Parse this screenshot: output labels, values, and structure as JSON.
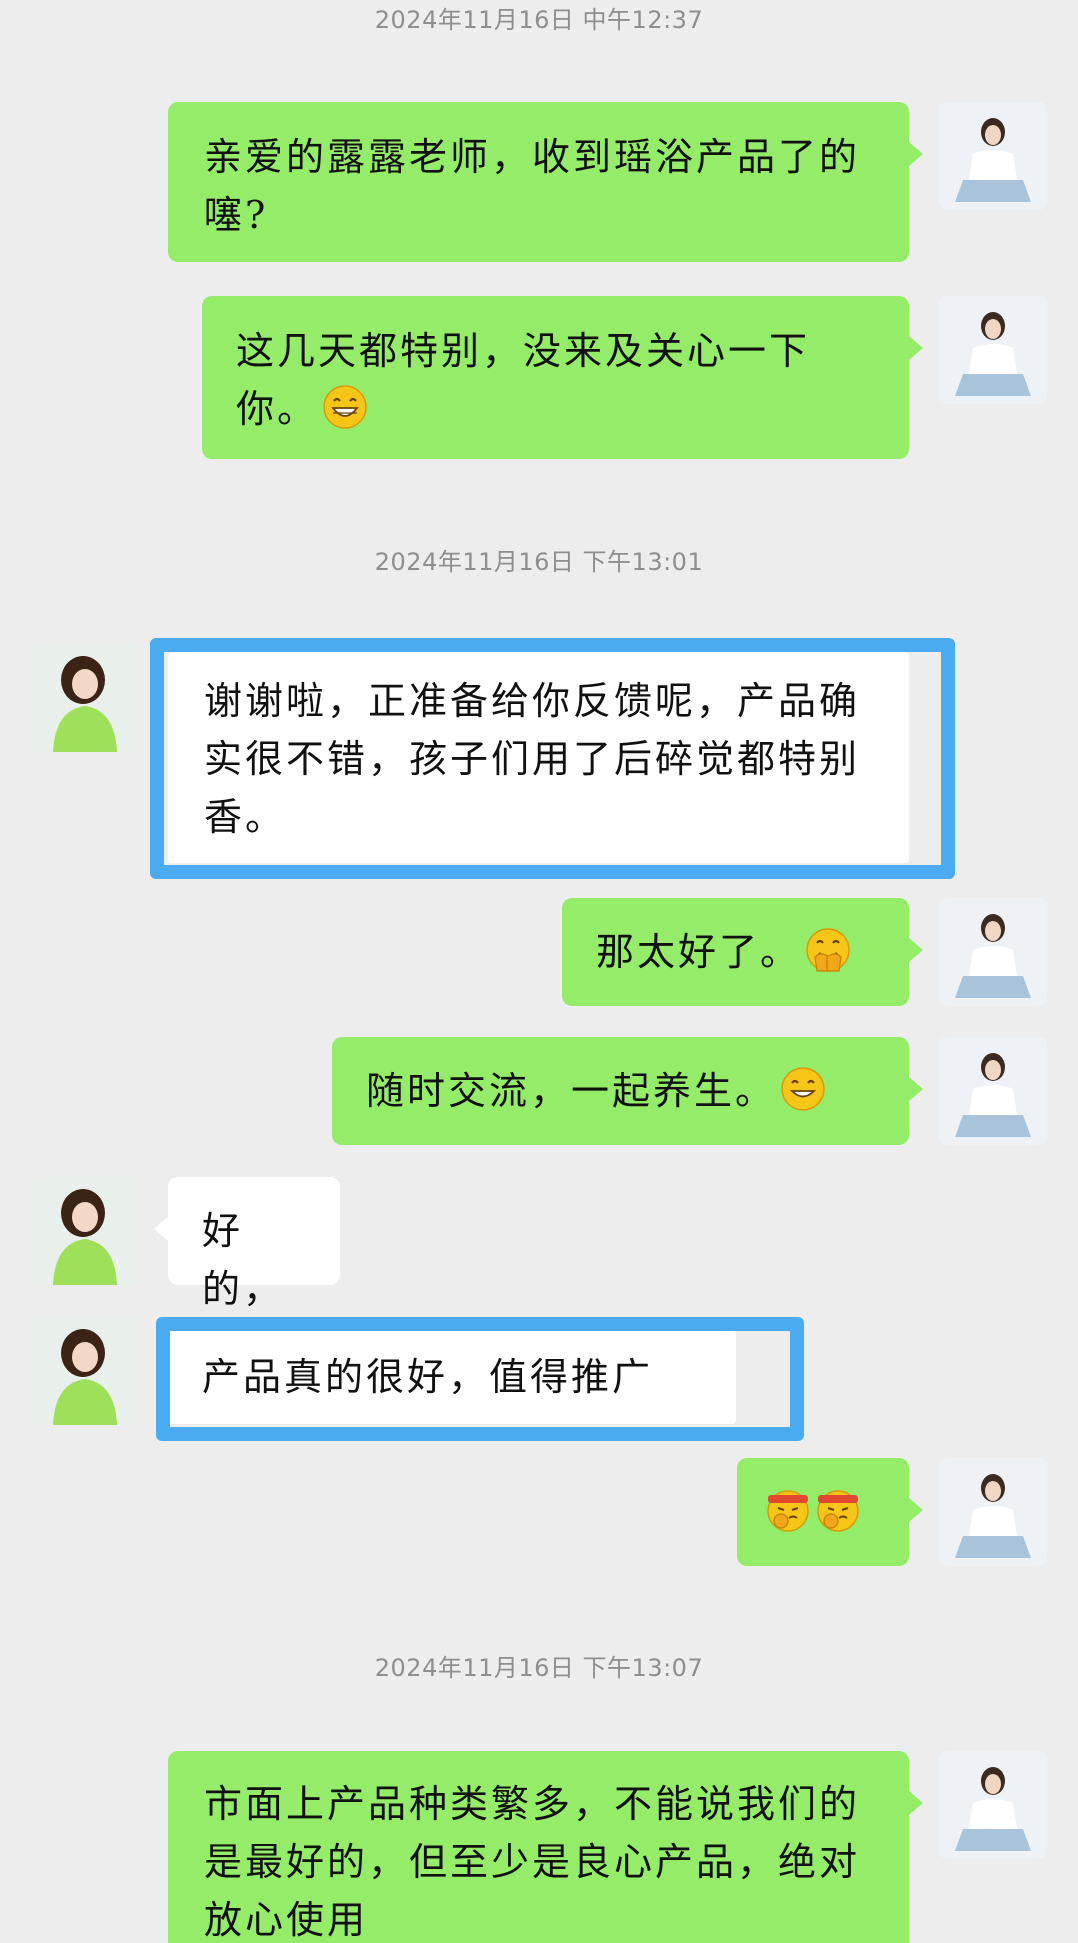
{
  "colors": {
    "background": "#ededed",
    "self_bubble": "#95ec69",
    "other_bubble": "#ffffff",
    "highlight_border": "#4aabf1",
    "timestamp_text": "#8e8e8e"
  },
  "timestamps": [
    "2024年11月16日  中午12:37",
    "2024年11月16日  下午13:01",
    "2024年11月16日  下午13:07"
  ],
  "messages": [
    {
      "sender": "self",
      "text": "亲爱的露露老师，收到瑶浴产品了的噻?"
    },
    {
      "sender": "self",
      "text": "这几天都特别，没来及关心一下你。",
      "emoji": "grinning-face"
    },
    {
      "sender": "other",
      "text": "谢谢啦，正准备给你反馈呢，产品确实很不错，孩子们用了后碎觉都特别香。",
      "highlighted": true
    },
    {
      "sender": "self",
      "text": "那太好了。",
      "emoji": "face-with-hand-over-mouth"
    },
    {
      "sender": "self",
      "text": "随时交流，一起养生。",
      "emoji": "smiling-face"
    },
    {
      "sender": "other",
      "text": "好的，"
    },
    {
      "sender": "other",
      "text": "产品真的很好，值得推广",
      "highlighted": true
    },
    {
      "sender": "self",
      "text": "",
      "emoji": "fighting-face-pair"
    },
    {
      "sender": "self",
      "text": "市面上产品种类繁多，不能说我们的是最好的，但至少是良心产品，绝对放心使用"
    }
  ]
}
